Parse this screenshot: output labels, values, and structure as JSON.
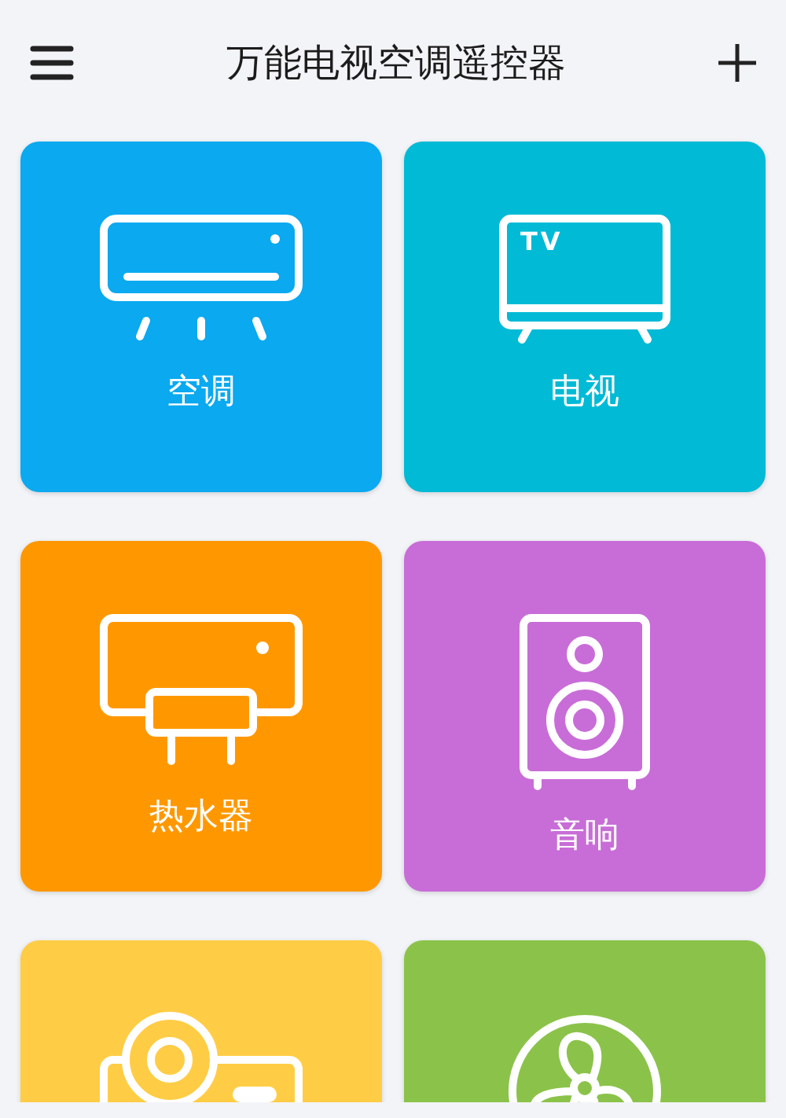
{
  "header": {
    "title": "万能电视空调遥控器"
  },
  "tiles": [
    {
      "kind": "ac",
      "label": "空调",
      "color": "#0aa9f0"
    },
    {
      "kind": "tv",
      "label": "电视",
      "icon_text": "TV",
      "color": "#00bad6"
    },
    {
      "kind": "heater",
      "label": "热水器",
      "color": "#ff9800"
    },
    {
      "kind": "speaker",
      "label": "音响",
      "color": "#c86dd7"
    },
    {
      "kind": "projector",
      "color": "#ffcd45"
    },
    {
      "kind": "fan",
      "color": "#8bc34a"
    }
  ]
}
